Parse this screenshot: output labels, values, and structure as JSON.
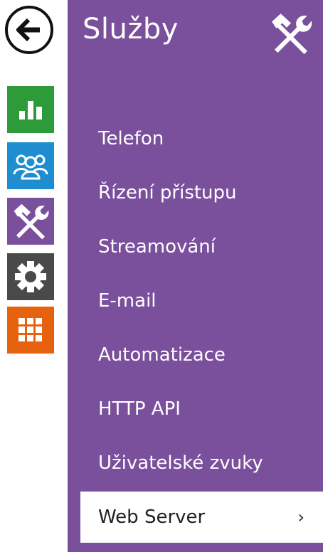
{
  "panel": {
    "title": "Služby",
    "header_icon": "tools-icon"
  },
  "back_icon": "arrow-left-icon",
  "rail": [
    {
      "name": "status",
      "icon": "bar-chart-icon",
      "color": "#2d9b3a"
    },
    {
      "name": "directory",
      "icon": "users-icon",
      "color": "#1f8ed0"
    },
    {
      "name": "services",
      "icon": "tools-icon",
      "color": "#7a4f9b"
    },
    {
      "name": "hardware",
      "icon": "gear-icon",
      "color": "#4a4a4a"
    },
    {
      "name": "system",
      "icon": "grid-icon",
      "color": "#e7620f"
    }
  ],
  "menu": {
    "items": [
      {
        "label": "Telefon"
      },
      {
        "label": "Řízení přístupu"
      },
      {
        "label": "Streamování"
      },
      {
        "label": "E-mail"
      },
      {
        "label": "Automatizace"
      },
      {
        "label": "HTTP API"
      },
      {
        "label": "Uživatelské zvuky"
      },
      {
        "label": "Web Server",
        "active": true,
        "chevron": "›"
      }
    ]
  },
  "colors": {
    "panel_bg": "#7a4f9b",
    "active_item_bg": "#ffffff",
    "menu_text": "#ffffff",
    "active_text": "#222222"
  }
}
